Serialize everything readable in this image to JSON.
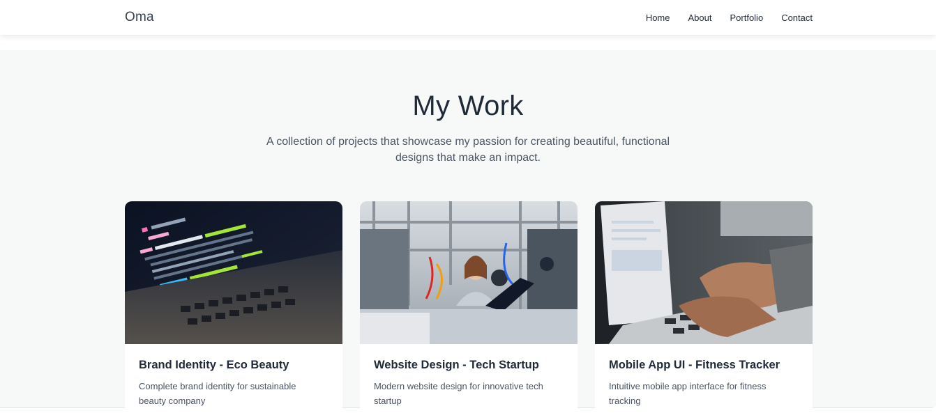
{
  "nav": {
    "brand": "Oma",
    "links": [
      {
        "label": "Home"
      },
      {
        "label": "About"
      },
      {
        "label": "Portfolio"
      },
      {
        "label": "Contact"
      }
    ]
  },
  "work": {
    "heading": "My Work",
    "subtitle": "A collection of projects that showcase my passion for creating beautiful, functional designs that make an impact.",
    "projects": [
      {
        "title": "Brand Identity - Eco Beauty",
        "description": "Complete brand identity for sustainable beauty company",
        "image": "code-on-laptop-screen-photo"
      },
      {
        "title": "Website Design - Tech Startup",
        "description": "Modern website design for innovative tech startup",
        "image": "woman-working-in-lab-photo"
      },
      {
        "title": "Mobile App UI - Fitness Tracker",
        "description": "Intuitive mobile app interface for fitness tracking",
        "image": "hands-typing-on-laptop-photo"
      }
    ]
  },
  "colors": {
    "section_bg": "#f7f9f8",
    "text_dark": "#1f2937",
    "text_muted": "#4b5563"
  }
}
